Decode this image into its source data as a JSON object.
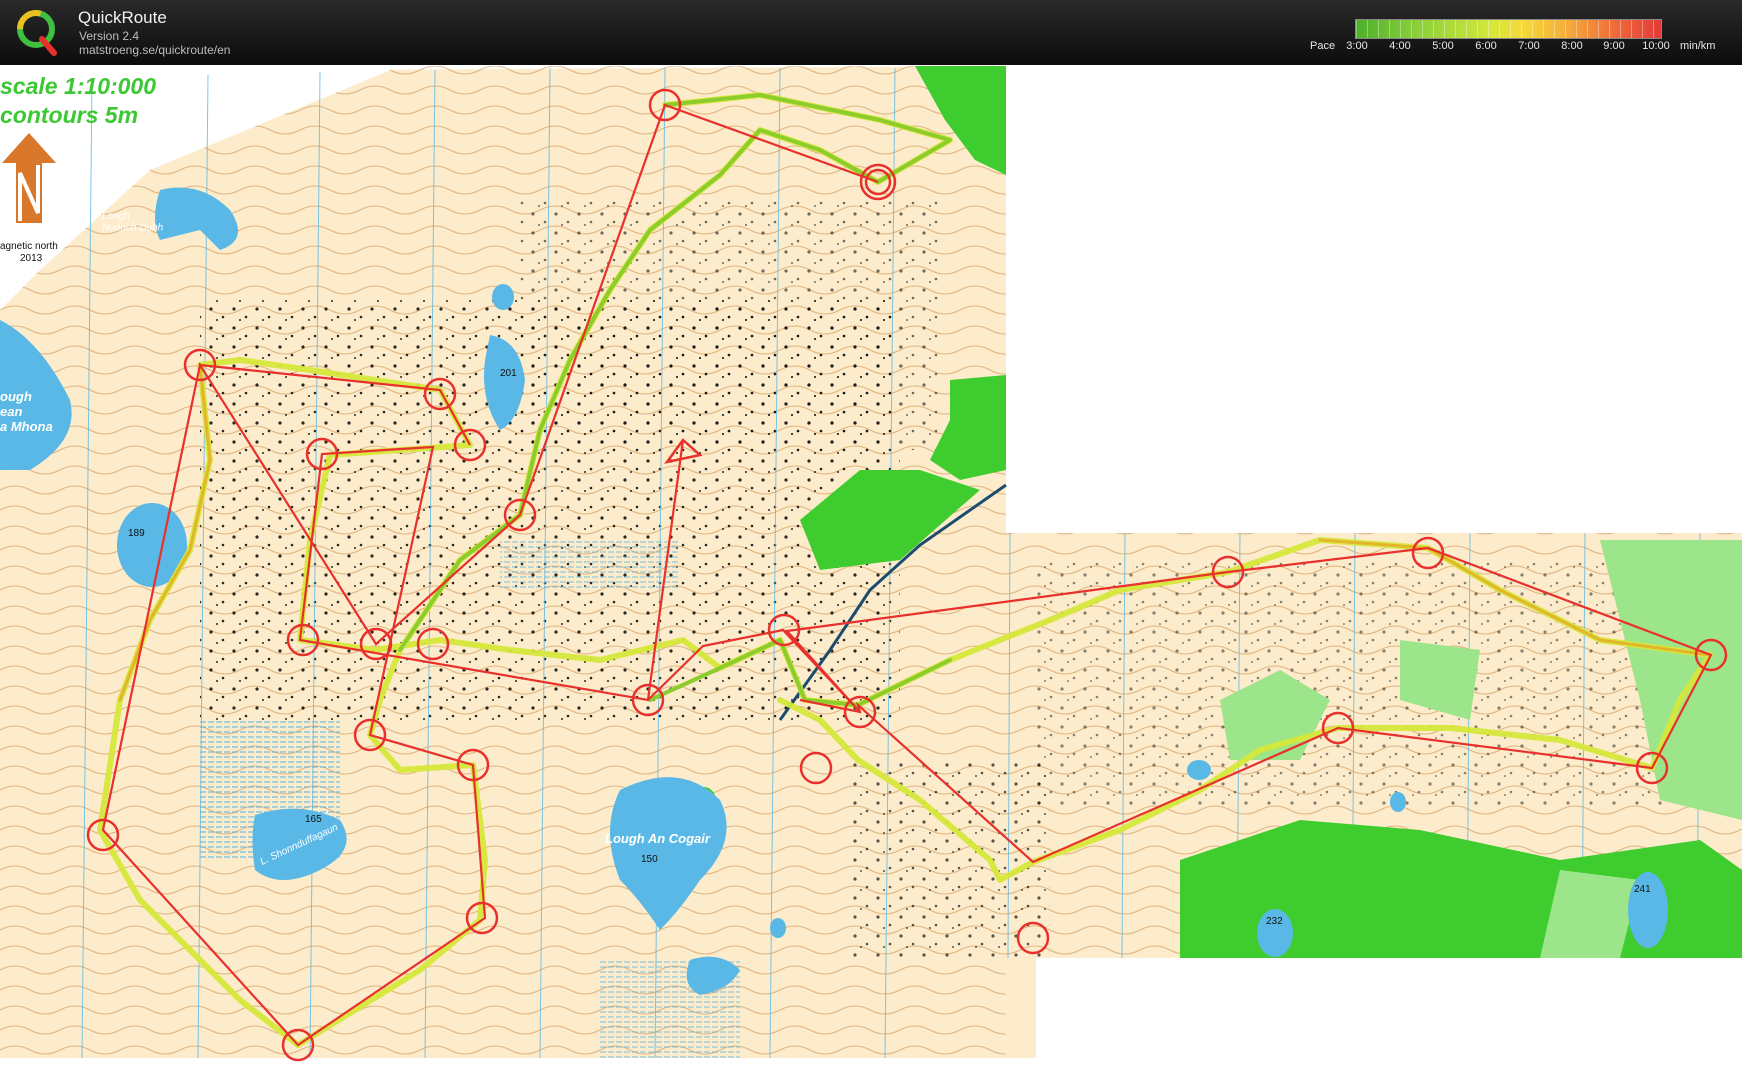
{
  "app": {
    "name": "QuickRoute",
    "version": "Version 2.4",
    "url": "matstroeng.se/quickroute/en"
  },
  "pace": {
    "label": "Pace",
    "ticks": [
      "3:00",
      "4:00",
      "5:00",
      "6:00",
      "7:00",
      "8:00",
      "9:00",
      "10:00"
    ],
    "unit": "min/km",
    "gradient_colors": [
      "#4caf2a",
      "#8bd03a",
      "#d6e83a",
      "#f5d93a",
      "#f5a93a",
      "#ef6a3a",
      "#e23a3a"
    ]
  },
  "map": {
    "scale_text": "scale 1:10:000",
    "contours_text": "contours 5m",
    "north_note_line1": "agnetic north",
    "north_note_line2": "2013",
    "labels": {
      "lake_nw": "Lough\nNoduch Dubh",
      "lake_west": "ough\nean\na Mhona",
      "lake_main": "Lough An Cogair",
      "height_201": "201",
      "height_189": "189",
      "height_165": "165",
      "lake_sw": "L. Shonnduffagaun",
      "height_150": "150",
      "height_232": "232",
      "height_241": "241"
    },
    "colors": {
      "open_land": "#fdeccb",
      "forest": "#3fcc2f",
      "forest_light": "#9de58a",
      "water": "#5ab8e6",
      "contour": "#c8853f",
      "control": "#e8302c",
      "route_fast": "#8ccc2d",
      "route_slow": "#e3b52c"
    }
  }
}
